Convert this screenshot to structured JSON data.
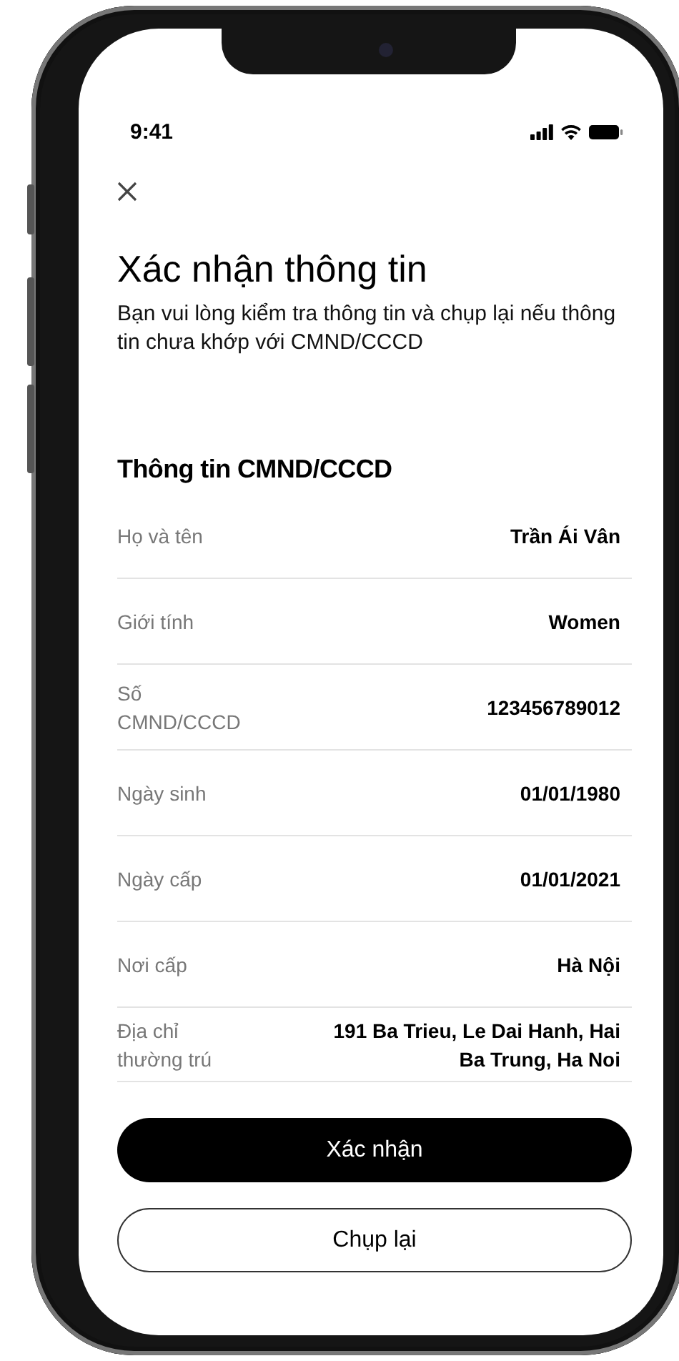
{
  "status_bar": {
    "time": "9:41"
  },
  "title": "Xác nhận thông tin",
  "subtitle": "Bạn vui lòng kiểm tra thông tin và chụp lại nếu thông tin chưa khớp với CMND/CCCD",
  "section": {
    "title": "Thông tin CMND/CCCD",
    "rows": [
      {
        "label": "Họ và tên",
        "value": "Trần Ái Vân"
      },
      {
        "label": "Giới tính",
        "value": "Women"
      },
      {
        "label": "Số CMND/CCCD",
        "value": "123456789012"
      },
      {
        "label": "Ngày sinh",
        "value": "01/01/1980"
      },
      {
        "label": "Ngày cấp",
        "value": "01/01/2021"
      },
      {
        "label": "Nơi cấp",
        "value": "Hà Nội"
      },
      {
        "label": "Địa chỉ thường trú",
        "value": "191 Ba Trieu, Le Dai Hanh, Hai Ba Trung, Ha Noi"
      }
    ]
  },
  "buttons": [
    {
      "label": "Xác nhận",
      "kind": "primary"
    },
    {
      "label": "Chụp lại",
      "kind": "secondary"
    }
  ]
}
